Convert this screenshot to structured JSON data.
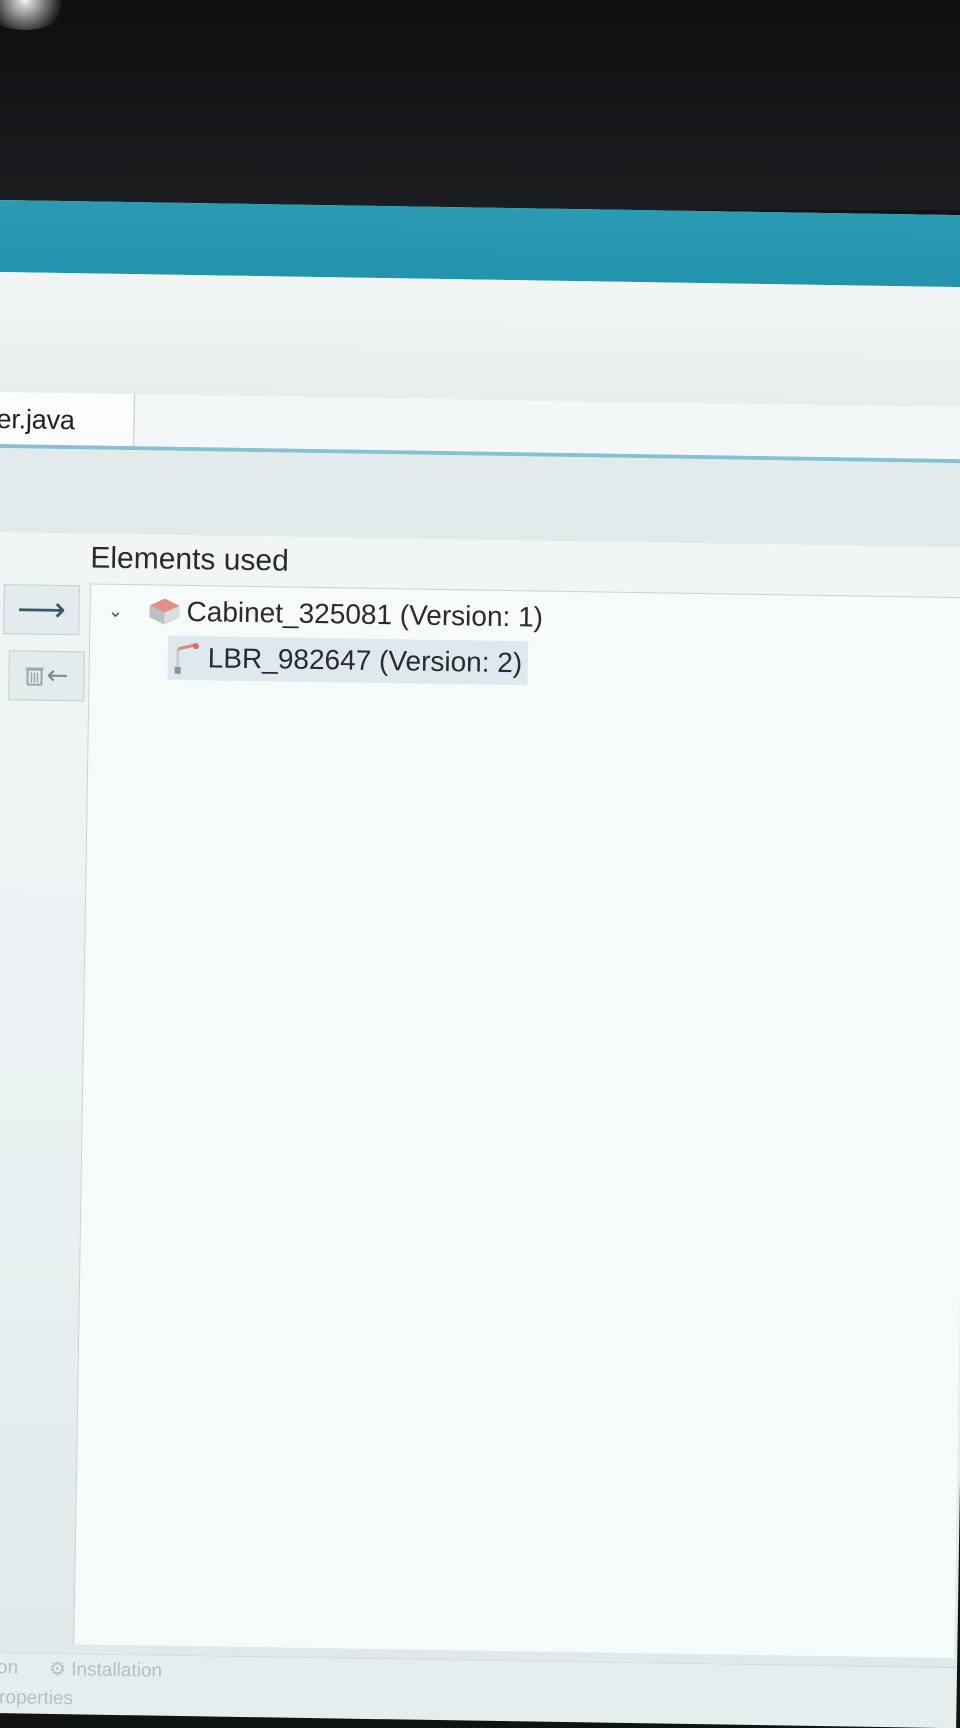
{
  "editor_tab": {
    "label": "er.java"
  },
  "panel": {
    "title": "Elements used"
  },
  "buttons": {
    "add": {
      "icon": "arrow-right-icon",
      "glyph": "⟶"
    },
    "remove": {
      "icon": "trash-arrow-left-icon",
      "glyph": "←"
    }
  },
  "tree": {
    "items": [
      {
        "label": "Cabinet_325081 (Version: 1)",
        "icon": "cabinet-icon",
        "expanded": true
      },
      {
        "label": "LBR_982647 (Version: 2)",
        "icon": "robot-arm-icon",
        "selected": true
      }
    ]
  },
  "status_bar": {
    "item_1": "ation",
    "item_2": "Installation",
    "item_3": "Properties"
  },
  "colors": {
    "title_bar": "#2394ad",
    "tab_underline": "#84c1d2",
    "selection": "#dde9ee"
  }
}
